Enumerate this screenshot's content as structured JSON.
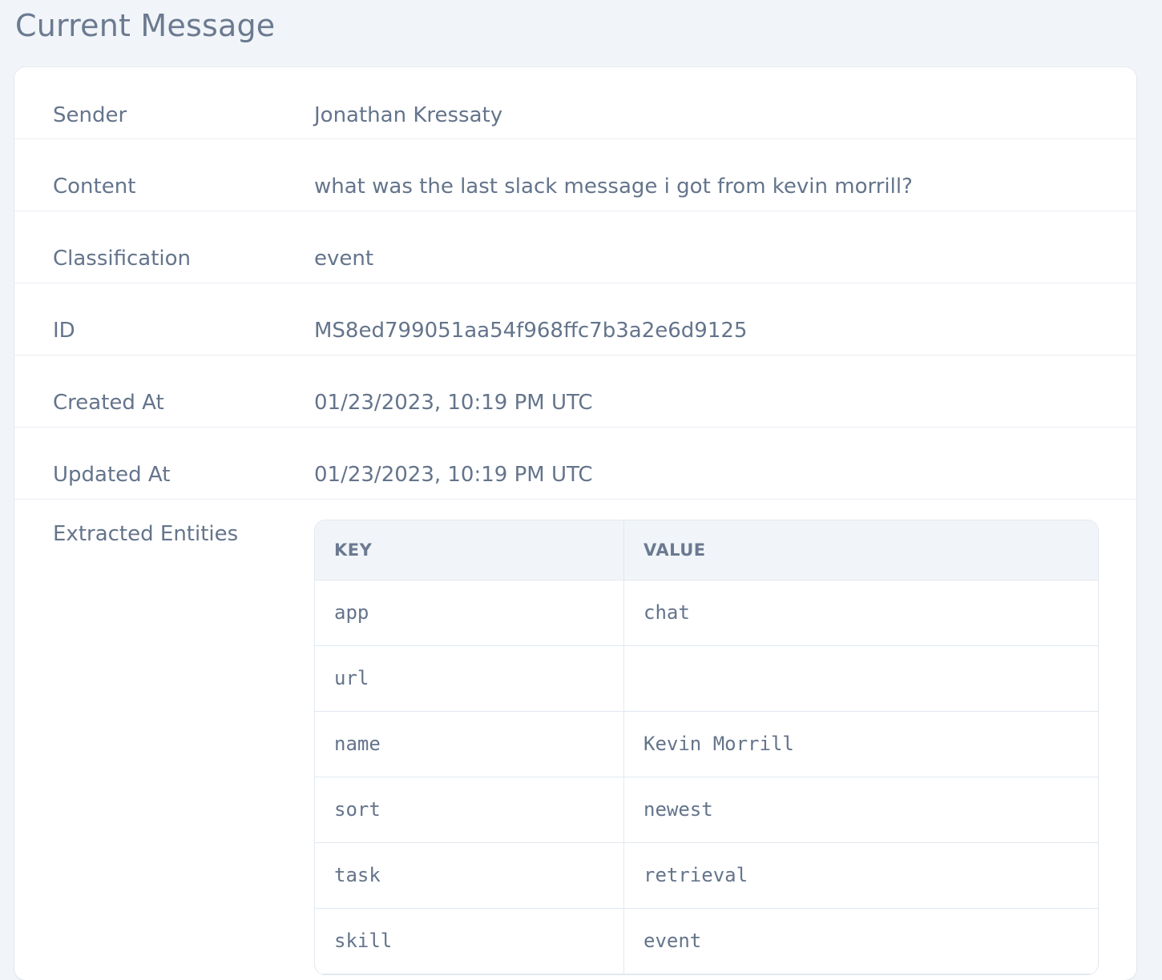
{
  "page": {
    "title": "Current Message"
  },
  "details": [
    {
      "label": "Sender",
      "value": "Jonathan Kressaty"
    },
    {
      "label": "Content",
      "value": "what was the last slack message i got from kevin morrill?"
    },
    {
      "label": "Classification",
      "value": "event"
    },
    {
      "label": "ID",
      "value": "MS8ed799051aa54f968ffc7b3a2e6d9125"
    },
    {
      "label": "Created At",
      "value": "01/23/2023, 10:19 PM UTC"
    },
    {
      "label": "Updated At",
      "value": "01/23/2023, 10:19 PM UTC"
    }
  ],
  "entities": {
    "label": "Extracted Entities",
    "headers": {
      "key": "KEY",
      "value": "VALUE"
    },
    "rows": [
      {
        "key": "app",
        "value": "chat"
      },
      {
        "key": "url",
        "value": ""
      },
      {
        "key": "name",
        "value": "Kevin Morrill"
      },
      {
        "key": "sort",
        "value": "newest"
      },
      {
        "key": "task",
        "value": "retrieval"
      },
      {
        "key": "skill",
        "value": "event"
      }
    ]
  }
}
